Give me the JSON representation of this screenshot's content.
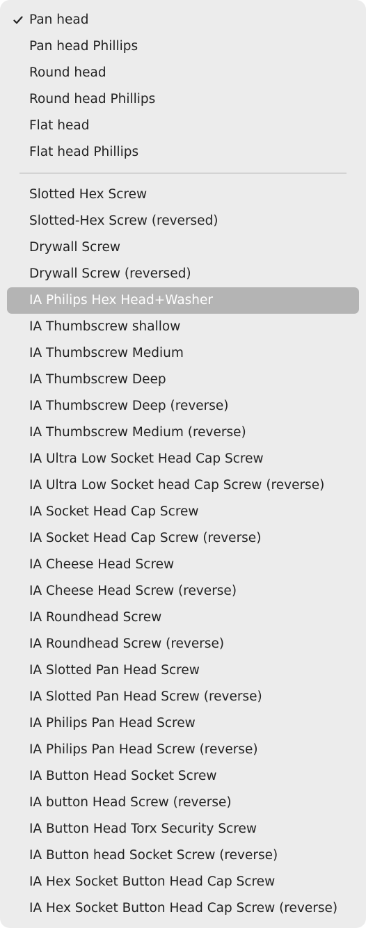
{
  "menu": {
    "selected_item": "Pan head",
    "highlighted_item": "IA Philips Hex Head+Washer",
    "colors": {
      "background": "#ececec",
      "highlight": "#b4b4b4",
      "text": "#222222",
      "highlight_text": "#ffffff",
      "separator": "#d3d3d3"
    },
    "group1": [
      {
        "label": "Pan head",
        "checked": true
      },
      {
        "label": "Pan head Phillips"
      },
      {
        "label": "Round head"
      },
      {
        "label": "Round head Phillips"
      },
      {
        "label": "Flat head"
      },
      {
        "label": "Flat head Phillips"
      }
    ],
    "group2": [
      {
        "label": "Slotted Hex Screw"
      },
      {
        "label": "Slotted-Hex Screw (reversed)"
      },
      {
        "label": "Drywall Screw"
      },
      {
        "label": "Drywall Screw (reversed)"
      },
      {
        "label": "IA Philips Hex Head+Washer",
        "highlighted": true
      },
      {
        "label": "IA Thumbscrew shallow"
      },
      {
        "label": "IA Thumbscrew Medium"
      },
      {
        "label": "IA Thumbscrew Deep"
      },
      {
        "label": "IA Thumbscrew Deep (reverse)"
      },
      {
        "label": "IA Thumbscrew Medium (reverse)"
      },
      {
        "label": "IA Ultra Low Socket Head Cap Screw"
      },
      {
        "label": "IA Ultra Low Socket head Cap Screw (reverse)"
      },
      {
        "label": "IA Socket Head Cap Screw"
      },
      {
        "label": "IA Socket Head Cap Screw (reverse)"
      },
      {
        "label": "IA Cheese Head Screw"
      },
      {
        "label": "IA Cheese Head Screw (reverse)"
      },
      {
        "label": "IA Roundhead Screw"
      },
      {
        "label": "IA Roundhead Screw (reverse)"
      },
      {
        "label": "IA Slotted Pan Head Screw"
      },
      {
        "label": "IA Slotted Pan Head Screw (reverse)"
      },
      {
        "label": "IA Philips Pan Head Screw"
      },
      {
        "label": "IA Philips Pan Head Screw (reverse)"
      },
      {
        "label": "IA Button Head Socket Screw"
      },
      {
        "label": "IA button Head Screw (reverse)"
      },
      {
        "label": "IA Button Head Torx Security Screw"
      },
      {
        "label": "IA Button head Socket Screw (reverse)"
      },
      {
        "label": "IA Hex Socket Button Head Cap Screw"
      },
      {
        "label": "IA Hex Socket Button Head Cap Screw (reverse)"
      }
    ]
  }
}
